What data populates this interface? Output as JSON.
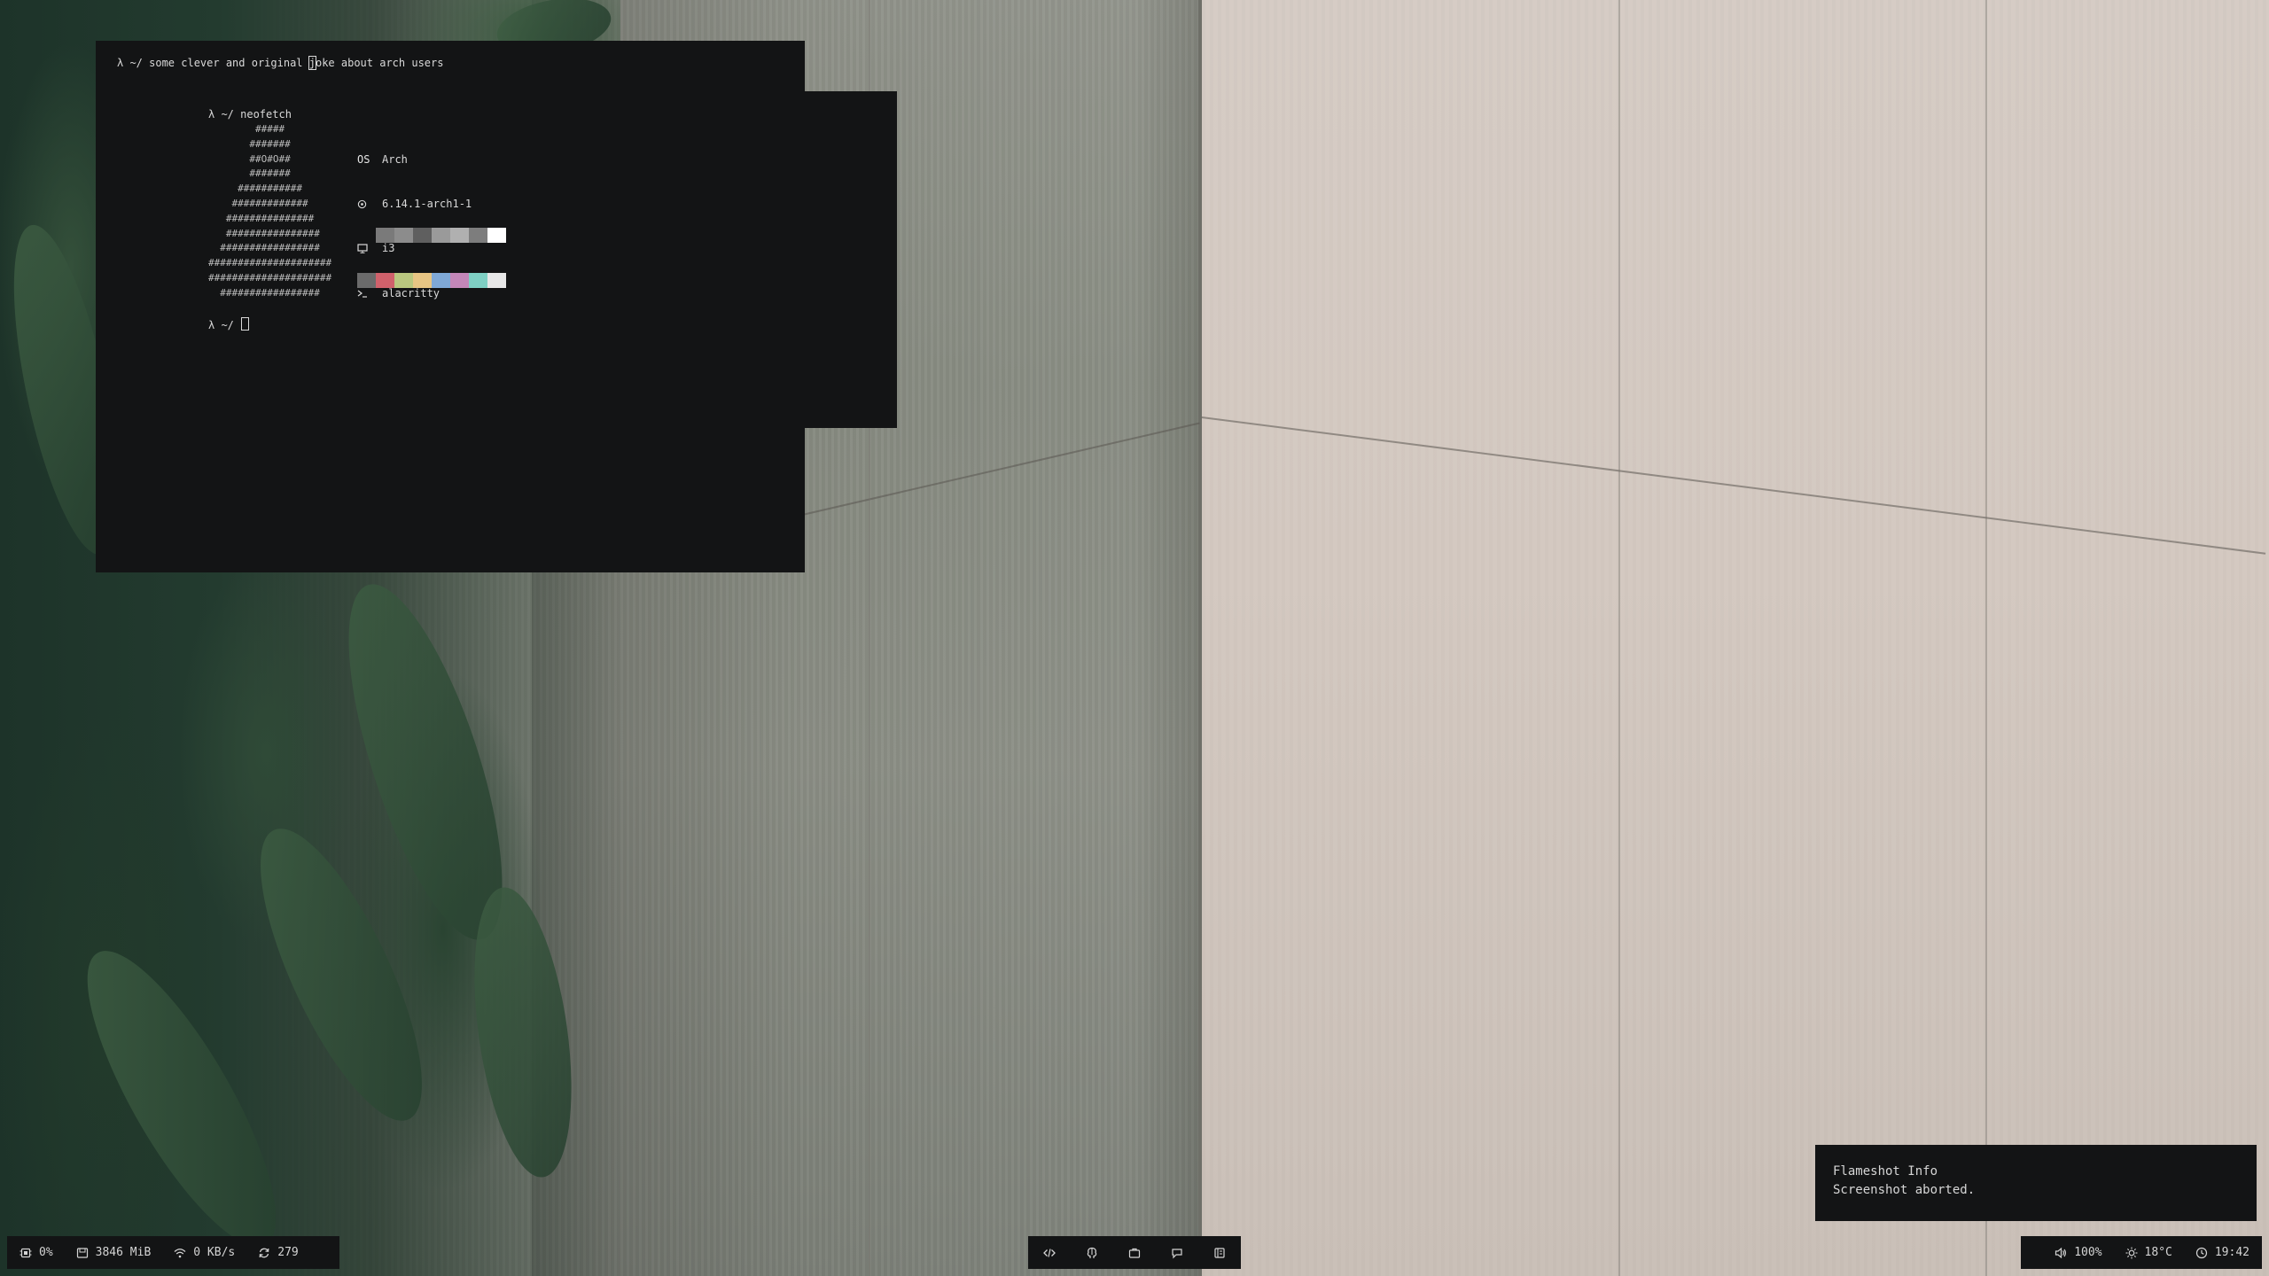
{
  "terminal_back": {
    "prompt": "λ ~/ some clever and original ",
    "cursor_char": "j",
    "prompt_rest": "oke about arch users"
  },
  "terminal_front": {
    "command": "λ ~/ neofetch",
    "ascii_art": "        #####\n       #######\n       ##O#O##\n       #######\n     ###########\n    #############\n   ###############\n   ################\n  #################\n#####################\n#####################\n  #################",
    "info": {
      "os_key": "OS",
      "os_value": "Arch",
      "kernel_value": "6.14.1-arch1-1",
      "wm_value": "i3",
      "terminal_value": "alacritty"
    },
    "palette_top": [
      "#131415",
      "#7a7a7a",
      "#8c8c8c",
      "#5f5f5f",
      "#9a9a9a",
      "#b0b0b0",
      "#7d7d7d",
      "#ffffff"
    ],
    "palette_bottom": [
      "#6b6b6b",
      "#d0616b",
      "#b9c77f",
      "#e7c584",
      "#7fa8d6",
      "#c487b9",
      "#7fd0c4",
      "#e8e8e8"
    ],
    "second_prompt": "λ ~/ "
  },
  "notification": {
    "title": "Flameshot Info",
    "body": "Screenshot aborted."
  },
  "status_left": {
    "cpu": "0%",
    "memory": "3846 MiB",
    "network": "0 KB/s",
    "updates": "279"
  },
  "status_mid": {
    "workspaces": [
      "code-icon",
      "brain-icon",
      "briefcase-icon",
      "chat-icon",
      "book-icon"
    ]
  },
  "status_right": {
    "volume": "100%",
    "temperature": "18°C",
    "clock": "19:42"
  }
}
